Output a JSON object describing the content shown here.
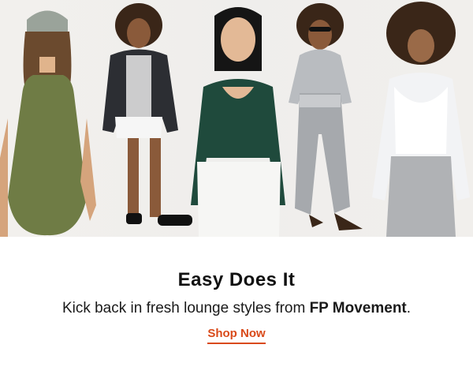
{
  "promo": {
    "image_alt": "Five models in FP Movement lounge styles",
    "headline": "Easy Does It",
    "subline_prefix": "Kick back in fresh lounge styles from ",
    "brand": "FP Movement",
    "subline_suffix": ".",
    "cta_label": "Shop Now"
  },
  "colors": {
    "accent": "#d94a1a",
    "text": "#111111",
    "background": "#ffffff",
    "banner_background": "#f0eeeb"
  }
}
